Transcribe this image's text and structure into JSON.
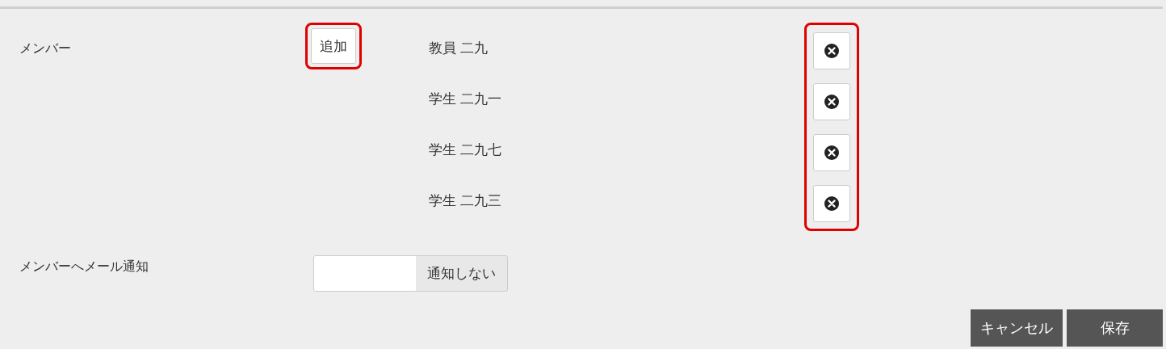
{
  "members": {
    "label": "メンバー",
    "add_button": {
      "label": "追加",
      "highlighted": true
    },
    "remove_highlighted": true,
    "items": [
      {
        "name": "教員 二九"
      },
      {
        "name": "学生 二九一"
      },
      {
        "name": "学生 二九七"
      },
      {
        "name": "学生 二九三"
      }
    ]
  },
  "notify": {
    "label": "メンバーへメール通知",
    "toggle": {
      "label": "通知しない",
      "on": false
    }
  },
  "buttons": [
    {
      "label": "キャンセル"
    },
    {
      "label": "保存"
    }
  ]
}
